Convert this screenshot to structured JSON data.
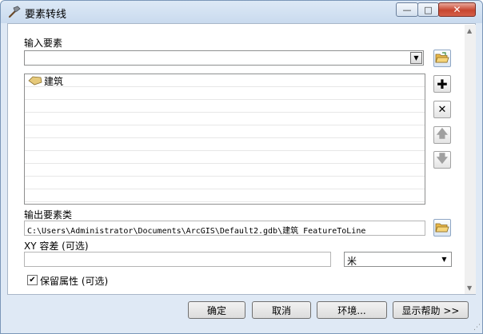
{
  "window": {
    "title": "要素转线",
    "minimize_glyph": "—",
    "maximize_glyph": "□",
    "close_glyph": "✕"
  },
  "input_features": {
    "label": "输入要素",
    "value": "",
    "dropdown_glyph": "▼",
    "items": [
      "建筑"
    ]
  },
  "side_buttons": {
    "add_glyph": "✚",
    "remove_glyph": "✕",
    "up_glyph": "🡅",
    "down_glyph": "🡇"
  },
  "output_feature_class": {
    "label": "输出要素类",
    "value": "C:\\Users\\Administrator\\Documents\\ArcGIS\\Default2.gdb\\建筑_FeatureToLine"
  },
  "xy_tolerance": {
    "label": "XY 容差 (可选)",
    "value": "",
    "unit": "米",
    "dropdown_glyph": "▼"
  },
  "preserve_attributes": {
    "label": "保留属性 (可选)",
    "checked": true,
    "check_glyph": "✔"
  },
  "buttons": {
    "ok": "确定",
    "cancel": "取消",
    "environments": "环境...",
    "show_help": "显示帮助 >>"
  },
  "colors": {
    "accent": "#dfe9f5",
    "folder": "#e8b84a",
    "layer_polygon": "#e6c97a"
  }
}
